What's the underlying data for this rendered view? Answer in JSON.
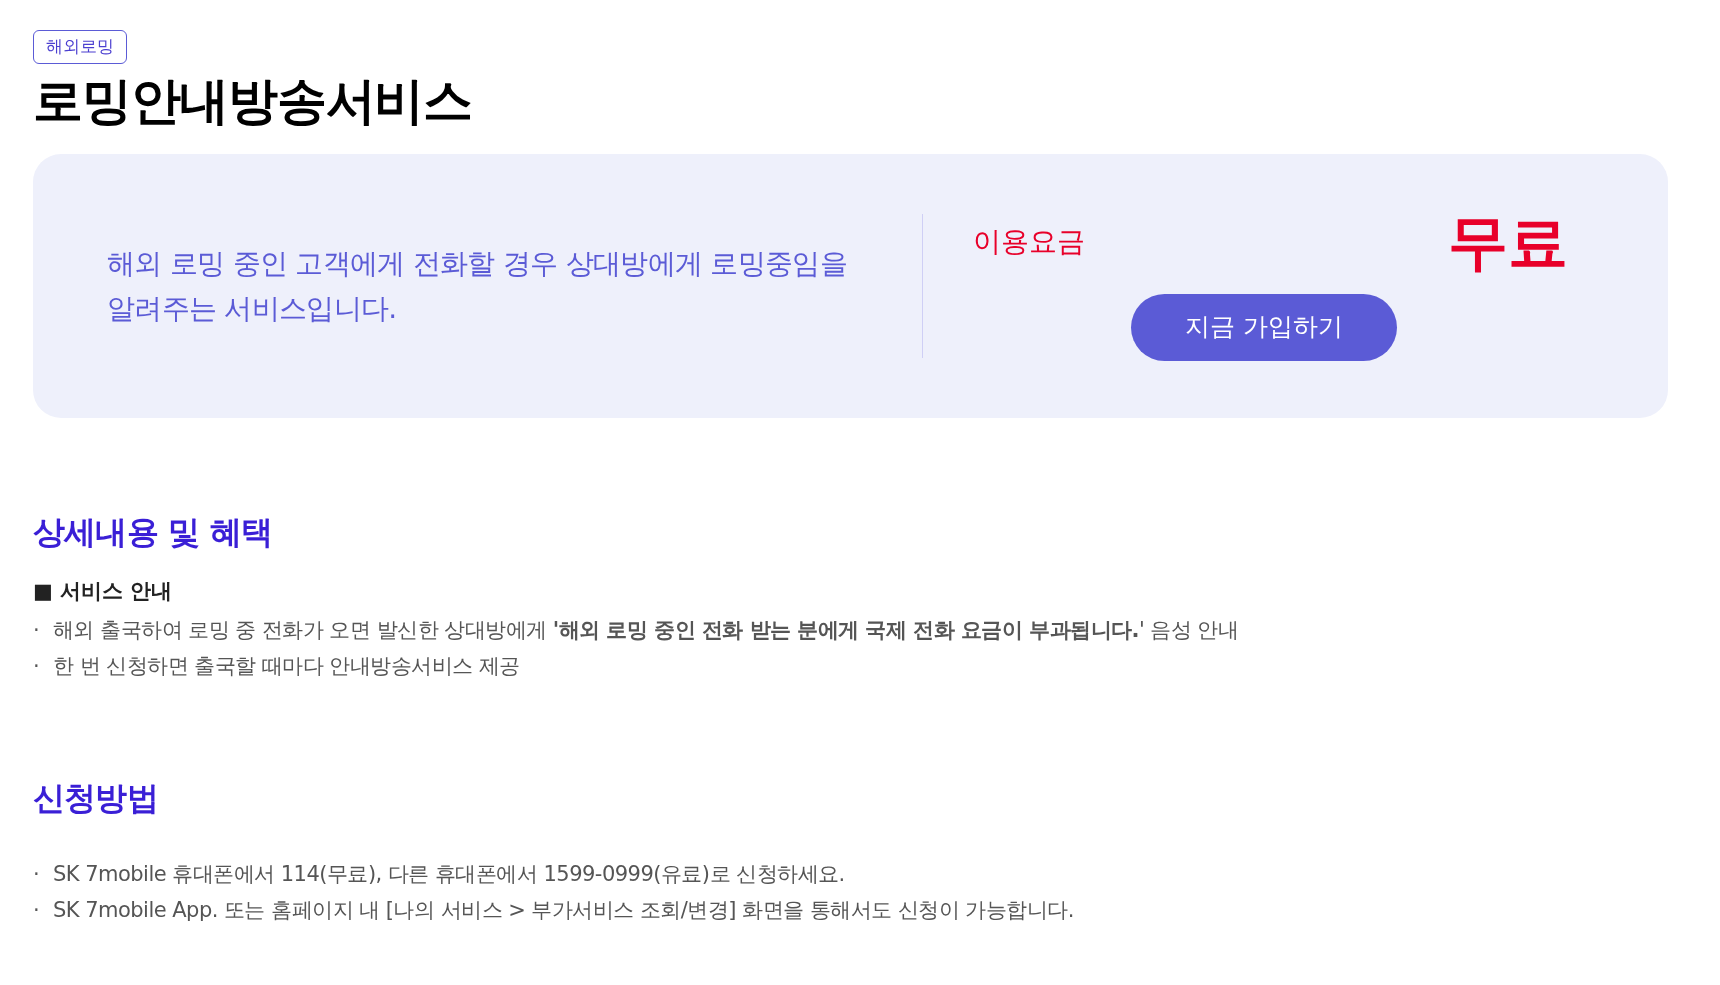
{
  "tag": "해외로밍",
  "title": "로밍안내방송서비스",
  "summary": {
    "description": "해외 로밍 중인 고객에게 전화할 경우 상대방에게 로밍중임을 알려주는 서비스입니다.",
    "fee_label": "이용요금",
    "fee_value": "무료",
    "button": "지금 가입하기"
  },
  "sections": [
    {
      "heading": "상세내용 및 혜택",
      "subheading": "■ 서비스 안내",
      "items": [
        {
          "bullet": "·",
          "text": "해외 출국하여 로밍 중 전화가 오면 발신한 상대방에게 **'해외 로밍 중인 전화 받는 분에게 국제 전화 요금이 부과됩니다.**' 음성 안내"
        },
        {
          "bullet": "·",
          "text": "한 번 신청하면 출국할 때마다 안내방송서비스 제공"
        }
      ]
    },
    {
      "heading": "신청방법",
      "items": [
        {
          "bullet": "·",
          "text": "SK 7mobile 휴대폰에서 114(무료), 다른 휴대폰에서 1599-0999(유료)로 신청하세요."
        },
        {
          "bullet": "·",
          "text": "SK 7mobile App. 또는 홈페이지 내 [나의 서비스 > 부가서비스 조회/변경] 화면을 통해서도 신청이 가능합니다."
        }
      ]
    }
  ]
}
